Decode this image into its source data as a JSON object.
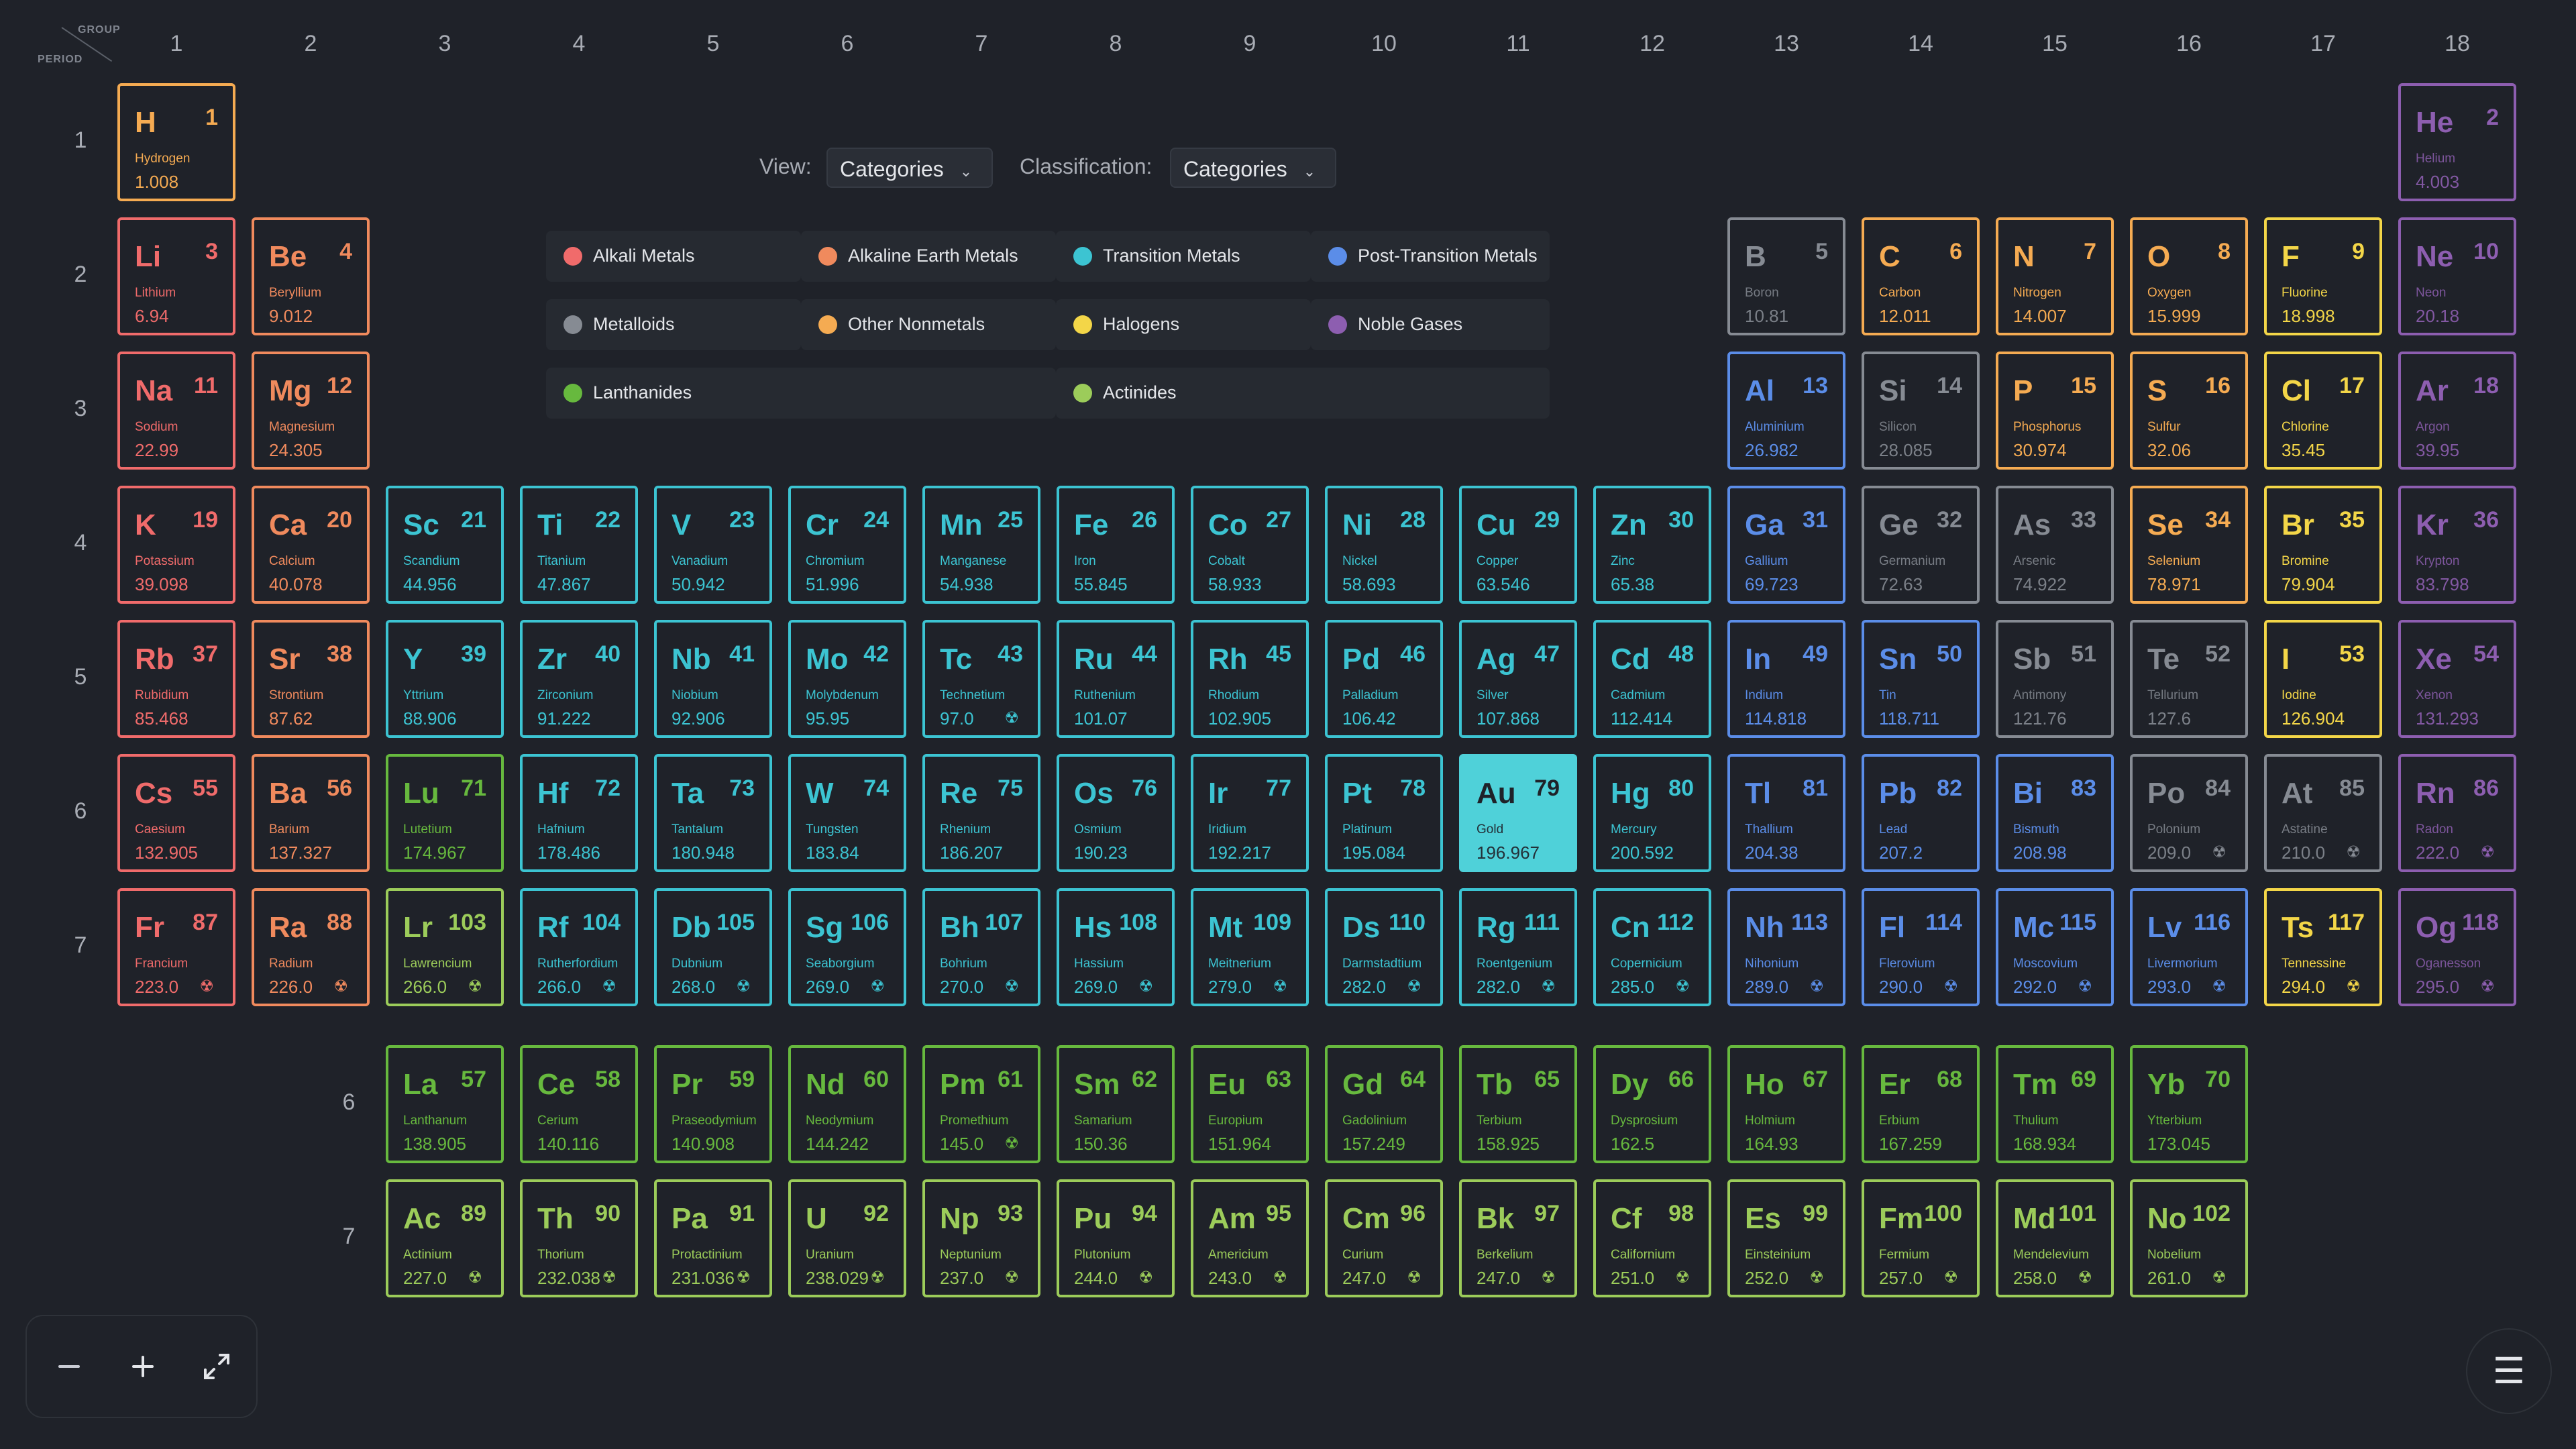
{
  "header": {
    "group_label": "GROUP",
    "period_label": "PERIOD"
  },
  "group_numbers": [
    "1",
    "2",
    "3",
    "4",
    "5",
    "6",
    "7",
    "8",
    "9",
    "10",
    "11",
    "12",
    "13",
    "14",
    "15",
    "16",
    "17",
    "18"
  ],
  "period_numbers": [
    "1",
    "2",
    "3",
    "4",
    "5",
    "6",
    "7"
  ],
  "fblock_period_numbers": [
    "6",
    "7"
  ],
  "controls": {
    "view_label": "View:",
    "view_value": "Categories",
    "classification_label": "Classification:",
    "classification_value": "Categories"
  },
  "colors": {
    "alkali": "#f06b6b",
    "alkaline": "#f08a5d",
    "transition": "#3cc4d2",
    "post": "#5b8de8",
    "metalloid": "#868b93",
    "nonmetal": "#f5ab52",
    "halogen": "#f3d648",
    "noble": "#8d5eb0",
    "lanthanide": "#67b93e",
    "actinide": "#9ccc5a"
  },
  "legend": [
    {
      "label": "Alkali Metals",
      "cat": "alkali"
    },
    {
      "label": "Alkaline Earth Metals",
      "cat": "alkaline"
    },
    {
      "label": "Transition Metals",
      "cat": "transition"
    },
    {
      "label": "Post-Transition Metals",
      "cat": "post"
    },
    {
      "label": "Metalloids",
      "cat": "metalloid"
    },
    {
      "label": "Other Nonmetals",
      "cat": "nonmetal"
    },
    {
      "label": "Halogens",
      "cat": "halogen"
    },
    {
      "label": "Noble Gases",
      "cat": "noble"
    },
    {
      "label": "Lanthanides",
      "cat": "lanthanide"
    },
    {
      "label": "Actinides",
      "cat": "actinide"
    }
  ],
  "selected_element": "Au",
  "radioactive_icon": "radiation-icon",
  "elements": [
    {
      "s": "H",
      "n": 1,
      "name": "Hydrogen",
      "m": "1.008",
      "g": 1,
      "p": 1,
      "c": "nonmetal"
    },
    {
      "s": "He",
      "n": 2,
      "name": "Helium",
      "m": "4.003",
      "g": 18,
      "p": 1,
      "c": "noble"
    },
    {
      "s": "Li",
      "n": 3,
      "name": "Lithium",
      "m": "6.94",
      "g": 1,
      "p": 2,
      "c": "alkali"
    },
    {
      "s": "Be",
      "n": 4,
      "name": "Beryllium",
      "m": "9.012",
      "g": 2,
      "p": 2,
      "c": "alkaline"
    },
    {
      "s": "B",
      "n": 5,
      "name": "Boron",
      "m": "10.81",
      "g": 13,
      "p": 2,
      "c": "metalloid"
    },
    {
      "s": "C",
      "n": 6,
      "name": "Carbon",
      "m": "12.011",
      "g": 14,
      "p": 2,
      "c": "nonmetal"
    },
    {
      "s": "N",
      "n": 7,
      "name": "Nitrogen",
      "m": "14.007",
      "g": 15,
      "p": 2,
      "c": "nonmetal"
    },
    {
      "s": "O",
      "n": 8,
      "name": "Oxygen",
      "m": "15.999",
      "g": 16,
      "p": 2,
      "c": "nonmetal"
    },
    {
      "s": "F",
      "n": 9,
      "name": "Fluorine",
      "m": "18.998",
      "g": 17,
      "p": 2,
      "c": "halogen"
    },
    {
      "s": "Ne",
      "n": 10,
      "name": "Neon",
      "m": "20.18",
      "g": 18,
      "p": 2,
      "c": "noble"
    },
    {
      "s": "Na",
      "n": 11,
      "name": "Sodium",
      "m": "22.99",
      "g": 1,
      "p": 3,
      "c": "alkali"
    },
    {
      "s": "Mg",
      "n": 12,
      "name": "Magnesium",
      "m": "24.305",
      "g": 2,
      "p": 3,
      "c": "alkaline"
    },
    {
      "s": "Al",
      "n": 13,
      "name": "Aluminium",
      "m": "26.982",
      "g": 13,
      "p": 3,
      "c": "post"
    },
    {
      "s": "Si",
      "n": 14,
      "name": "Silicon",
      "m": "28.085",
      "g": 14,
      "p": 3,
      "c": "metalloid"
    },
    {
      "s": "P",
      "n": 15,
      "name": "Phosphorus",
      "m": "30.974",
      "g": 15,
      "p": 3,
      "c": "nonmetal"
    },
    {
      "s": "S",
      "n": 16,
      "name": "Sulfur",
      "m": "32.06",
      "g": 16,
      "p": 3,
      "c": "nonmetal"
    },
    {
      "s": "Cl",
      "n": 17,
      "name": "Chlorine",
      "m": "35.45",
      "g": 17,
      "p": 3,
      "c": "halogen"
    },
    {
      "s": "Ar",
      "n": 18,
      "name": "Argon",
      "m": "39.95",
      "g": 18,
      "p": 3,
      "c": "noble"
    },
    {
      "s": "K",
      "n": 19,
      "name": "Potassium",
      "m": "39.098",
      "g": 1,
      "p": 4,
      "c": "alkali"
    },
    {
      "s": "Ca",
      "n": 20,
      "name": "Calcium",
      "m": "40.078",
      "g": 2,
      "p": 4,
      "c": "alkaline"
    },
    {
      "s": "Sc",
      "n": 21,
      "name": "Scandium",
      "m": "44.956",
      "g": 3,
      "p": 4,
      "c": "transition"
    },
    {
      "s": "Ti",
      "n": 22,
      "name": "Titanium",
      "m": "47.867",
      "g": 4,
      "p": 4,
      "c": "transition"
    },
    {
      "s": "V",
      "n": 23,
      "name": "Vanadium",
      "m": "50.942",
      "g": 5,
      "p": 4,
      "c": "transition"
    },
    {
      "s": "Cr",
      "n": 24,
      "name": "Chromium",
      "m": "51.996",
      "g": 6,
      "p": 4,
      "c": "transition"
    },
    {
      "s": "Mn",
      "n": 25,
      "name": "Manganese",
      "m": "54.938",
      "g": 7,
      "p": 4,
      "c": "transition"
    },
    {
      "s": "Fe",
      "n": 26,
      "name": "Iron",
      "m": "55.845",
      "g": 8,
      "p": 4,
      "c": "transition"
    },
    {
      "s": "Co",
      "n": 27,
      "name": "Cobalt",
      "m": "58.933",
      "g": 9,
      "p": 4,
      "c": "transition"
    },
    {
      "s": "Ni",
      "n": 28,
      "name": "Nickel",
      "m": "58.693",
      "g": 10,
      "p": 4,
      "c": "transition"
    },
    {
      "s": "Cu",
      "n": 29,
      "name": "Copper",
      "m": "63.546",
      "g": 11,
      "p": 4,
      "c": "transition"
    },
    {
      "s": "Zn",
      "n": 30,
      "name": "Zinc",
      "m": "65.38",
      "g": 12,
      "p": 4,
      "c": "transition"
    },
    {
      "s": "Ga",
      "n": 31,
      "name": "Gallium",
      "m": "69.723",
      "g": 13,
      "p": 4,
      "c": "post"
    },
    {
      "s": "Ge",
      "n": 32,
      "name": "Germanium",
      "m": "72.63",
      "g": 14,
      "p": 4,
      "c": "metalloid"
    },
    {
      "s": "As",
      "n": 33,
      "name": "Arsenic",
      "m": "74.922",
      "g": 15,
      "p": 4,
      "c": "metalloid"
    },
    {
      "s": "Se",
      "n": 34,
      "name": "Selenium",
      "m": "78.971",
      "g": 16,
      "p": 4,
      "c": "nonmetal"
    },
    {
      "s": "Br",
      "n": 35,
      "name": "Bromine",
      "m": "79.904",
      "g": 17,
      "p": 4,
      "c": "halogen"
    },
    {
      "s": "Kr",
      "n": 36,
      "name": "Krypton",
      "m": "83.798",
      "g": 18,
      "p": 4,
      "c": "noble"
    },
    {
      "s": "Rb",
      "n": 37,
      "name": "Rubidium",
      "m": "85.468",
      "g": 1,
      "p": 5,
      "c": "alkali"
    },
    {
      "s": "Sr",
      "n": 38,
      "name": "Strontium",
      "m": "87.62",
      "g": 2,
      "p": 5,
      "c": "alkaline"
    },
    {
      "s": "Y",
      "n": 39,
      "name": "Yttrium",
      "m": "88.906",
      "g": 3,
      "p": 5,
      "c": "transition"
    },
    {
      "s": "Zr",
      "n": 40,
      "name": "Zirconium",
      "m": "91.222",
      "g": 4,
      "p": 5,
      "c": "transition"
    },
    {
      "s": "Nb",
      "n": 41,
      "name": "Niobium",
      "m": "92.906",
      "g": 5,
      "p": 5,
      "c": "transition"
    },
    {
      "s": "Mo",
      "n": 42,
      "name": "Molybdenum",
      "m": "95.95",
      "g": 6,
      "p": 5,
      "c": "transition"
    },
    {
      "s": "Tc",
      "n": 43,
      "name": "Technetium",
      "m": "97.0",
      "g": 7,
      "p": 5,
      "c": "transition",
      "r": true
    },
    {
      "s": "Ru",
      "n": 44,
      "name": "Ruthenium",
      "m": "101.07",
      "g": 8,
      "p": 5,
      "c": "transition"
    },
    {
      "s": "Rh",
      "n": 45,
      "name": "Rhodium",
      "m": "102.905",
      "g": 9,
      "p": 5,
      "c": "transition"
    },
    {
      "s": "Pd",
      "n": 46,
      "name": "Palladium",
      "m": "106.42",
      "g": 10,
      "p": 5,
      "c": "transition"
    },
    {
      "s": "Ag",
      "n": 47,
      "name": "Silver",
      "m": "107.868",
      "g": 11,
      "p": 5,
      "c": "transition"
    },
    {
      "s": "Cd",
      "n": 48,
      "name": "Cadmium",
      "m": "112.414",
      "g": 12,
      "p": 5,
      "c": "transition"
    },
    {
      "s": "In",
      "n": 49,
      "name": "Indium",
      "m": "114.818",
      "g": 13,
      "p": 5,
      "c": "post"
    },
    {
      "s": "Sn",
      "n": 50,
      "name": "Tin",
      "m": "118.711",
      "g": 14,
      "p": 5,
      "c": "post"
    },
    {
      "s": "Sb",
      "n": 51,
      "name": "Antimony",
      "m": "121.76",
      "g": 15,
      "p": 5,
      "c": "metalloid"
    },
    {
      "s": "Te",
      "n": 52,
      "name": "Tellurium",
      "m": "127.6",
      "g": 16,
      "p": 5,
      "c": "metalloid"
    },
    {
      "s": "I",
      "n": 53,
      "name": "Iodine",
      "m": "126.904",
      "g": 17,
      "p": 5,
      "c": "halogen"
    },
    {
      "s": "Xe",
      "n": 54,
      "name": "Xenon",
      "m": "131.293",
      "g": 18,
      "p": 5,
      "c": "noble"
    },
    {
      "s": "Cs",
      "n": 55,
      "name": "Caesium",
      "m": "132.905",
      "g": 1,
      "p": 6,
      "c": "alkali"
    },
    {
      "s": "Ba",
      "n": 56,
      "name": "Barium",
      "m": "137.327",
      "g": 2,
      "p": 6,
      "c": "alkaline"
    },
    {
      "s": "Lu",
      "n": 71,
      "name": "Lutetium",
      "m": "174.967",
      "g": 3,
      "p": 6,
      "c": "lanthanide"
    },
    {
      "s": "Hf",
      "n": 72,
      "name": "Hafnium",
      "m": "178.486",
      "g": 4,
      "p": 6,
      "c": "transition"
    },
    {
      "s": "Ta",
      "n": 73,
      "name": "Tantalum",
      "m": "180.948",
      "g": 5,
      "p": 6,
      "c": "transition"
    },
    {
      "s": "W",
      "n": 74,
      "name": "Tungsten",
      "m": "183.84",
      "g": 6,
      "p": 6,
      "c": "transition"
    },
    {
      "s": "Re",
      "n": 75,
      "name": "Rhenium",
      "m": "186.207",
      "g": 7,
      "p": 6,
      "c": "transition"
    },
    {
      "s": "Os",
      "n": 76,
      "name": "Osmium",
      "m": "190.23",
      "g": 8,
      "p": 6,
      "c": "transition"
    },
    {
      "s": "Ir",
      "n": 77,
      "name": "Iridium",
      "m": "192.217",
      "g": 9,
      "p": 6,
      "c": "transition"
    },
    {
      "s": "Pt",
      "n": 78,
      "name": "Platinum",
      "m": "195.084",
      "g": 10,
      "p": 6,
      "c": "transition"
    },
    {
      "s": "Au",
      "n": 79,
      "name": "Gold",
      "m": "196.967",
      "g": 11,
      "p": 6,
      "c": "transition"
    },
    {
      "s": "Hg",
      "n": 80,
      "name": "Mercury",
      "m": "200.592",
      "g": 12,
      "p": 6,
      "c": "transition"
    },
    {
      "s": "Tl",
      "n": 81,
      "name": "Thallium",
      "m": "204.38",
      "g": 13,
      "p": 6,
      "c": "post"
    },
    {
      "s": "Pb",
      "n": 82,
      "name": "Lead",
      "m": "207.2",
      "g": 14,
      "p": 6,
      "c": "post"
    },
    {
      "s": "Bi",
      "n": 83,
      "name": "Bismuth",
      "m": "208.98",
      "g": 15,
      "p": 6,
      "c": "post"
    },
    {
      "s": "Po",
      "n": 84,
      "name": "Polonium",
      "m": "209.0",
      "g": 16,
      "p": 6,
      "c": "metalloid",
      "r": true
    },
    {
      "s": "At",
      "n": 85,
      "name": "Astatine",
      "m": "210.0",
      "g": 17,
      "p": 6,
      "c": "metalloid",
      "r": true
    },
    {
      "s": "Rn",
      "n": 86,
      "name": "Radon",
      "m": "222.0",
      "g": 18,
      "p": 6,
      "c": "noble",
      "r": true
    },
    {
      "s": "Fr",
      "n": 87,
      "name": "Francium",
      "m": "223.0",
      "g": 1,
      "p": 7,
      "c": "alkali",
      "r": true
    },
    {
      "s": "Ra",
      "n": 88,
      "name": "Radium",
      "m": "226.0",
      "g": 2,
      "p": 7,
      "c": "alkaline",
      "r": true
    },
    {
      "s": "Lr",
      "n": 103,
      "name": "Lawrencium",
      "m": "266.0",
      "g": 3,
      "p": 7,
      "c": "actinide",
      "r": true
    },
    {
      "s": "Rf",
      "n": 104,
      "name": "Rutherfordium",
      "m": "266.0",
      "g": 4,
      "p": 7,
      "c": "transition",
      "r": true
    },
    {
      "s": "Db",
      "n": 105,
      "name": "Dubnium",
      "m": "268.0",
      "g": 5,
      "p": 7,
      "c": "transition",
      "r": true
    },
    {
      "s": "Sg",
      "n": 106,
      "name": "Seaborgium",
      "m": "269.0",
      "g": 6,
      "p": 7,
      "c": "transition",
      "r": true
    },
    {
      "s": "Bh",
      "n": 107,
      "name": "Bohrium",
      "m": "270.0",
      "g": 7,
      "p": 7,
      "c": "transition",
      "r": true
    },
    {
      "s": "Hs",
      "n": 108,
      "name": "Hassium",
      "m": "269.0",
      "g": 8,
      "p": 7,
      "c": "transition",
      "r": true
    },
    {
      "s": "Mt",
      "n": 109,
      "name": "Meitnerium",
      "m": "279.0",
      "g": 9,
      "p": 7,
      "c": "transition",
      "r": true
    },
    {
      "s": "Ds",
      "n": 110,
      "name": "Darmstadtium",
      "m": "282.0",
      "g": 10,
      "p": 7,
      "c": "transition",
      "r": true
    },
    {
      "s": "Rg",
      "n": 111,
      "name": "Roentgenium",
      "m": "282.0",
      "g": 11,
      "p": 7,
      "c": "transition",
      "r": true
    },
    {
      "s": "Cn",
      "n": 112,
      "name": "Copernicium",
      "m": "285.0",
      "g": 12,
      "p": 7,
      "c": "transition",
      "r": true
    },
    {
      "s": "Nh",
      "n": 113,
      "name": "Nihonium",
      "m": "289.0",
      "g": 13,
      "p": 7,
      "c": "post",
      "r": true
    },
    {
      "s": "Fl",
      "n": 114,
      "name": "Flerovium",
      "m": "290.0",
      "g": 14,
      "p": 7,
      "c": "post",
      "r": true
    },
    {
      "s": "Mc",
      "n": 115,
      "name": "Moscovium",
      "m": "292.0",
      "g": 15,
      "p": 7,
      "c": "post",
      "r": true
    },
    {
      "s": "Lv",
      "n": 116,
      "name": "Livermorium",
      "m": "293.0",
      "g": 16,
      "p": 7,
      "c": "post",
      "r": true
    },
    {
      "s": "Ts",
      "n": 117,
      "name": "Tennessine",
      "m": "294.0",
      "g": 17,
      "p": 7,
      "c": "halogen",
      "r": true
    },
    {
      "s": "Og",
      "n": 118,
      "name": "Oganesson",
      "m": "295.0",
      "g": 18,
      "p": 7,
      "c": "noble",
      "r": true
    },
    {
      "s": "La",
      "n": 57,
      "name": "Lanthanum",
      "m": "138.905",
      "g": 3,
      "p": 9,
      "c": "lanthanide"
    },
    {
      "s": "Ce",
      "n": 58,
      "name": "Cerium",
      "m": "140.116",
      "g": 4,
      "p": 9,
      "c": "lanthanide"
    },
    {
      "s": "Pr",
      "n": 59,
      "name": "Praseodymium",
      "m": "140.908",
      "g": 5,
      "p": 9,
      "c": "lanthanide"
    },
    {
      "s": "Nd",
      "n": 60,
      "name": "Neodymium",
      "m": "144.242",
      "g": 6,
      "p": 9,
      "c": "lanthanide"
    },
    {
      "s": "Pm",
      "n": 61,
      "name": "Promethium",
      "m": "145.0",
      "g": 7,
      "p": 9,
      "c": "lanthanide",
      "r": true
    },
    {
      "s": "Sm",
      "n": 62,
      "name": "Samarium",
      "m": "150.36",
      "g": 8,
      "p": 9,
      "c": "lanthanide"
    },
    {
      "s": "Eu",
      "n": 63,
      "name": "Europium",
      "m": "151.964",
      "g": 9,
      "p": 9,
      "c": "lanthanide"
    },
    {
      "s": "Gd",
      "n": 64,
      "name": "Gadolinium",
      "m": "157.249",
      "g": 10,
      "p": 9,
      "c": "lanthanide"
    },
    {
      "s": "Tb",
      "n": 65,
      "name": "Terbium",
      "m": "158.925",
      "g": 11,
      "p": 9,
      "c": "lanthanide"
    },
    {
      "s": "Dy",
      "n": 66,
      "name": "Dysprosium",
      "m": "162.5",
      "g": 12,
      "p": 9,
      "c": "lanthanide"
    },
    {
      "s": "Ho",
      "n": 67,
      "name": "Holmium",
      "m": "164.93",
      "g": 13,
      "p": 9,
      "c": "lanthanide"
    },
    {
      "s": "Er",
      "n": 68,
      "name": "Erbium",
      "m": "167.259",
      "g": 14,
      "p": 9,
      "c": "lanthanide"
    },
    {
      "s": "Tm",
      "n": 69,
      "name": "Thulium",
      "m": "168.934",
      "g": 15,
      "p": 9,
      "c": "lanthanide"
    },
    {
      "s": "Yb",
      "n": 70,
      "name": "Ytterbium",
      "m": "173.045",
      "g": 16,
      "p": 9,
      "c": "lanthanide"
    },
    {
      "s": "Ac",
      "n": 89,
      "name": "Actinium",
      "m": "227.0",
      "g": 3,
      "p": 10,
      "c": "actinide",
      "r": true
    },
    {
      "s": "Th",
      "n": 90,
      "name": "Thorium",
      "m": "232.038",
      "g": 4,
      "p": 10,
      "c": "actinide",
      "r": true
    },
    {
      "s": "Pa",
      "n": 91,
      "name": "Protactinium",
      "m": "231.036",
      "g": 5,
      "p": 10,
      "c": "actinide",
      "r": true
    },
    {
      "s": "U",
      "n": 92,
      "name": "Uranium",
      "m": "238.029",
      "g": 6,
      "p": 10,
      "c": "actinide",
      "r": true
    },
    {
      "s": "Np",
      "n": 93,
      "name": "Neptunium",
      "m": "237.0",
      "g": 7,
      "p": 10,
      "c": "actinide",
      "r": true
    },
    {
      "s": "Pu",
      "n": 94,
      "name": "Plutonium",
      "m": "244.0",
      "g": 8,
      "p": 10,
      "c": "actinide",
      "r": true
    },
    {
      "s": "Am",
      "n": 95,
      "name": "Americium",
      "m": "243.0",
      "g": 9,
      "p": 10,
      "c": "actinide",
      "r": true
    },
    {
      "s": "Cm",
      "n": 96,
      "name": "Curium",
      "m": "247.0",
      "g": 10,
      "p": 10,
      "c": "actinide",
      "r": true
    },
    {
      "s": "Bk",
      "n": 97,
      "name": "Berkelium",
      "m": "247.0",
      "g": 11,
      "p": 10,
      "c": "actinide",
      "r": true
    },
    {
      "s": "Cf",
      "n": 98,
      "name": "Californium",
      "m": "251.0",
      "g": 12,
      "p": 10,
      "c": "actinide",
      "r": true
    },
    {
      "s": "Es",
      "n": 99,
      "name": "Einsteinium",
      "m": "252.0",
      "g": 13,
      "p": 10,
      "c": "actinide",
      "r": true
    },
    {
      "s": "Fm",
      "n": 100,
      "name": "Fermium",
      "m": "257.0",
      "g": 14,
      "p": 10,
      "c": "actinide",
      "r": true
    },
    {
      "s": "Md",
      "n": 101,
      "name": "Mendelevium",
      "m": "258.0",
      "g": 15,
      "p": 10,
      "c": "actinide",
      "r": true
    },
    {
      "s": "No",
      "n": 102,
      "name": "Nobelium",
      "m": "261.0",
      "g": 16,
      "p": 10,
      "c": "actinide",
      "r": true
    }
  ]
}
